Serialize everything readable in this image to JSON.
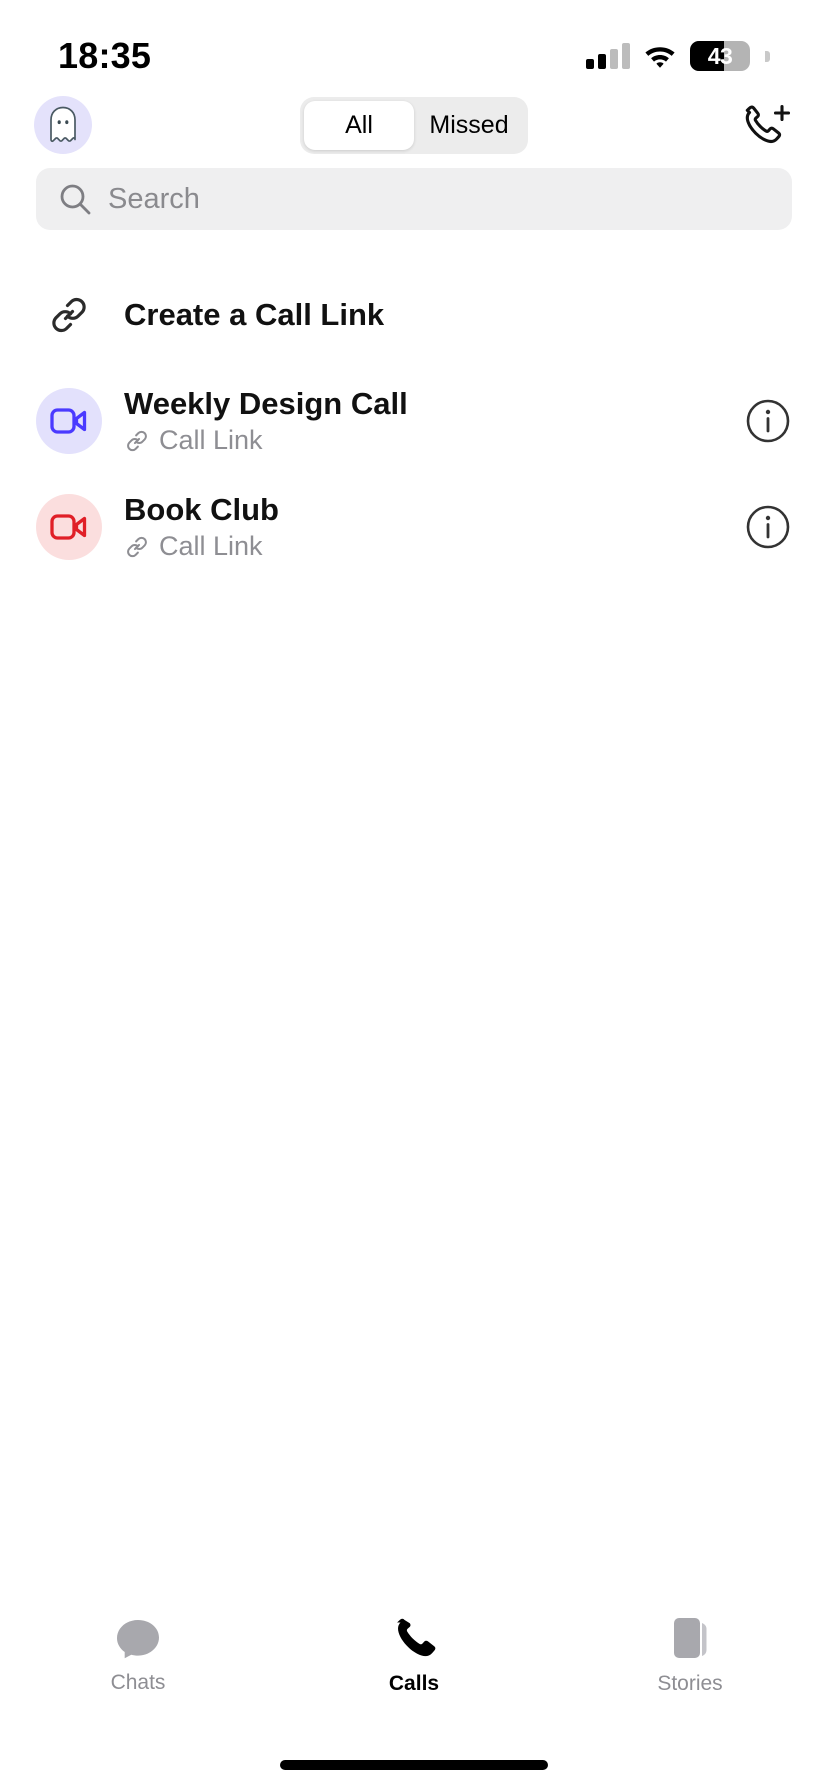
{
  "status_bar": {
    "time": "18:35",
    "signal_icon": "cellular-signal-icon",
    "signal_bars_filled": 2,
    "signal_bars_total": 4,
    "wifi_icon": "wifi-icon",
    "battery_icon": "battery-icon",
    "battery_percent": "43",
    "battery_level": 43
  },
  "header": {
    "avatar_icon": "ghost-avatar-icon",
    "avatar_bg": "#e4e2fb",
    "segmented": {
      "options": [
        {
          "label": "All",
          "active": true
        },
        {
          "label": "Missed",
          "active": false
        }
      ]
    },
    "new_call_icon": "phone-plus-icon"
  },
  "search": {
    "icon": "search-icon",
    "placeholder": "Search",
    "value": ""
  },
  "create_link_row": {
    "icon": "link-icon",
    "label": "Create a Call Link"
  },
  "calls": [
    {
      "title": "Weekly Design Call",
      "subtitle": "Call Link",
      "subtitle_icon": "link-icon",
      "avatar_icon": "video-camera-icon",
      "accent": "#4a3aff",
      "avatar_bg": "#e3e1fc",
      "info_icon": "info-circle-icon"
    },
    {
      "title": "Book Club",
      "subtitle": "Call Link",
      "subtitle_icon": "link-icon",
      "avatar_icon": "video-camera-icon",
      "accent": "#e01f27",
      "avatar_bg": "#fbdede",
      "info_icon": "info-circle-icon"
    }
  ],
  "tabbar": {
    "tabs": [
      {
        "label": "Chats",
        "icon": "chat-bubble-icon",
        "active": false
      },
      {
        "label": "Calls",
        "icon": "phone-icon",
        "active": true
      },
      {
        "label": "Stories",
        "icon": "stories-icon",
        "active": false
      }
    ]
  },
  "colors": {
    "accent_blue": "#4a3aff",
    "accent_red": "#e01f27",
    "search_bg": "#efeff0",
    "segment_bg": "#ececec",
    "muted_text": "#8e8e93"
  }
}
